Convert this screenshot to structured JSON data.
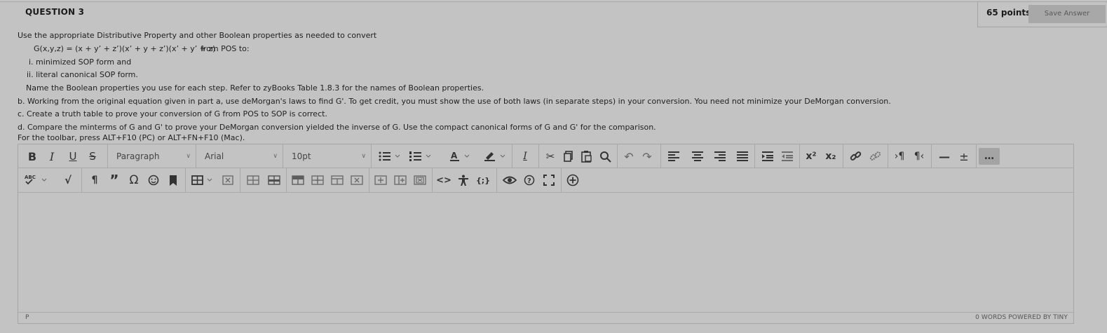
{
  "question": {
    "title": "QUESTION 3",
    "points": "65 points",
    "save_label": "Save Answer",
    "lines": {
      "intro": "Use the appropriate Distributive Property and other Boolean properties as needed to convert",
      "equation": "G(x,y,z) = (x + y’ + z’)(x’ + y + z’)(x’ + y’ + z)",
      "equation_suffix": "from POS to:",
      "item_i": "i. minimized SOP form and",
      "item_ii": "ii. literal canonical SOP form.",
      "name_props": "Name the Boolean properties you use for each step. Refer to zyBooks Table 1.8.3 for the names of Boolean properties.",
      "part_b": "b. Working from the original equation given in part a, use deMorgan's laws to find G'. To get credit, you must show the use of both laws (in separate steps) in your conversion. You need not minimize your DeMorgan conversion.",
      "part_c": "c. Create a truth table to prove your conversion of G from POS to SOP is correct.",
      "part_d": "d. Compare the minterms of G and G' to prove your DeMorgan conversion yielded the inverse of G. Use the compact canonical forms of G and G' for the comparison.",
      "toolbar_hint": "For the toolbar, press ALT+F10 (PC) or ALT+FN+F10 (Mac)."
    }
  },
  "editor": {
    "block_format": "Paragraph",
    "font_family": "Arial",
    "font_size": "10pt",
    "status_path": "P",
    "status_right": "0 WORDS  POWERED BY TINY",
    "toolbar_row1_icons": [
      "bold-icon",
      "italic-icon",
      "underline-icon",
      "strikethrough-icon",
      "bullet-list-icon",
      "numbered-list-icon",
      "text-color-icon",
      "highlight-icon",
      "clear-format-icon",
      "cut-icon",
      "copy-icon",
      "paste-icon",
      "search-icon",
      "undo-icon",
      "redo-icon",
      "align-left-icon",
      "align-center-icon",
      "align-right-icon",
      "justify-icon",
      "indent-icon",
      "outdent-icon",
      "superscript-icon",
      "subscript-icon",
      "link-icon",
      "unlink-icon",
      "ltr-icon",
      "rtl-icon",
      "horizontal-rule-icon",
      "plus-minus-icon",
      "more-icon"
    ],
    "toolbar_row2_icons": [
      "spellcheck-icon",
      "math-icon",
      "paragraph-mark-icon",
      "quote-icon",
      "omega-icon",
      "emoji-icon",
      "bookmark-icon",
      "table-icon",
      "delete-table-icon",
      "table-row-before-icon",
      "table-row-after-icon",
      "table-col-before-icon",
      "table-col-after-icon",
      "table-merge-icon",
      "table-delete-col-icon",
      "table-insert-row-icon",
      "table-insert-col-icon",
      "table-delete-row-icon",
      "code-icon",
      "accessibility-icon",
      "code-sample-icon",
      "preview-icon",
      "help-icon",
      "fullscreen-icon",
      "add-content-icon"
    ]
  }
}
